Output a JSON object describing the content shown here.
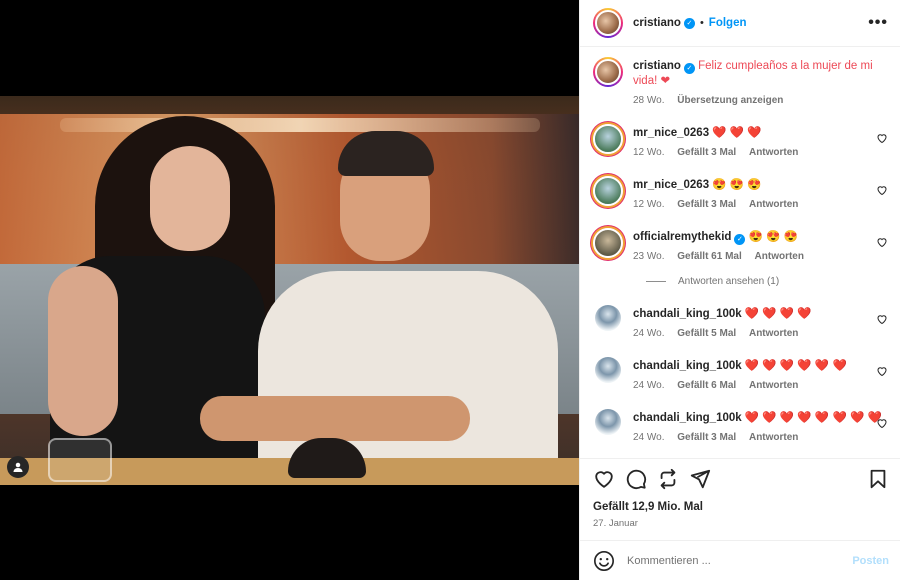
{
  "post": {
    "author": "cristiano",
    "follow_label": "Folgen",
    "more_label": "•••",
    "separator": "•"
  },
  "caption": {
    "author": "cristiano",
    "text": "Feliz cumpleaños a la mujer de mi vida! ❤",
    "age": "28 Wo.",
    "translate_label": "Übersetzung anzeigen"
  },
  "comments": [
    {
      "user": "mr_nice_0263",
      "text": "❤️ ❤️ ❤️",
      "age": "12 Wo.",
      "likes": "Gefällt 3 Mal",
      "reply": "Antworten",
      "verified": false
    },
    {
      "user": "mr_nice_0263",
      "text": "😍 😍 😍",
      "age": "12 Wo.",
      "likes": "Gefällt 3 Mal",
      "reply": "Antworten",
      "verified": false
    },
    {
      "user": "officialremythekid",
      "text": "😍 😍 😍",
      "age": "23 Wo.",
      "likes": "Gefällt 61 Mal",
      "reply": "Antworten",
      "verified": true
    },
    {
      "user": "chandali_king_100k",
      "text": "❤️ ❤️ ❤️ ❤️",
      "age": "24 Wo.",
      "likes": "Gefällt 5 Mal",
      "reply": "Antworten",
      "verified": false
    },
    {
      "user": "chandali_king_100k",
      "text": "❤️ ❤️ ❤️ ❤️ ❤️ ❤️",
      "age": "24 Wo.",
      "likes": "Gefällt 6 Mal",
      "reply": "Antworten",
      "verified": false
    },
    {
      "user": "chandali_king_100k",
      "text": "❤️ ❤️ ❤️ ❤️ ❤️ ❤️ ❤️ ❤️",
      "age": "24 Wo.",
      "likes": "Gefällt 3 Mal",
      "reply": "Antworten",
      "verified": false
    }
  ],
  "replies_label": "Antworten ansehen (1)",
  "stats": {
    "likes": "Gefällt 12,9 Mio. Mal",
    "date": "27. Januar"
  },
  "composer": {
    "placeholder": "Kommentieren ...",
    "post_label": "Posten"
  },
  "colors": {
    "link": "#0095f6",
    "heart": "#ed4956"
  }
}
